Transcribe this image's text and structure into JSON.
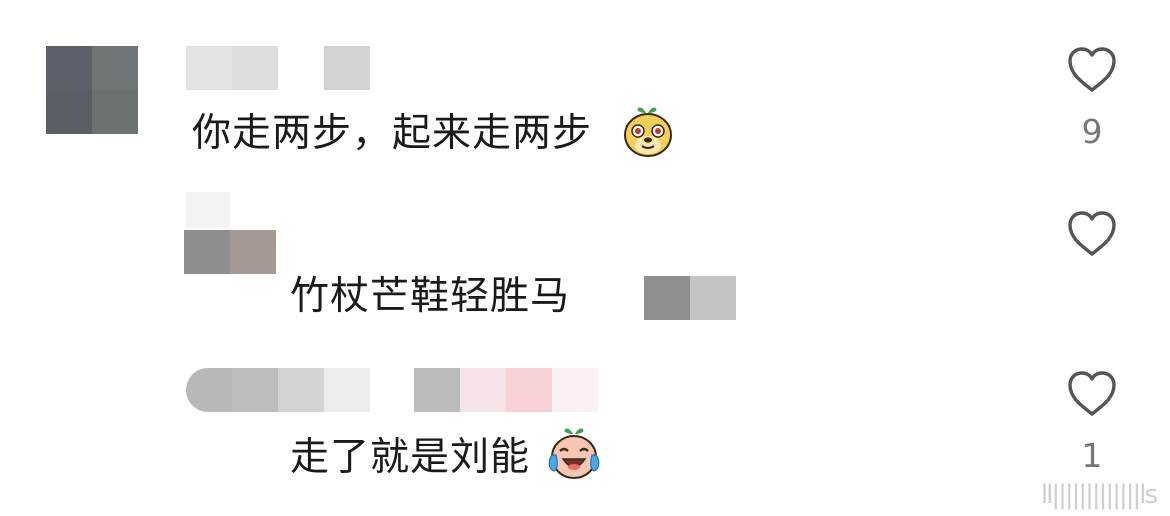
{
  "comments": [
    {
      "text": "你走两步，起来走两步",
      "emoji": "dog-face-emoji",
      "likes": "9",
      "avatar_colors": [
        "#5c6169",
        "#6f7477",
        "#5a5f66",
        "#6c7172"
      ],
      "username_colors": [
        "#e3e3e3",
        "#dcdcdc",
        "#ffffff",
        "#d2d2d2"
      ]
    },
    {
      "text": "竹杖芒鞋轻胜马",
      "likes": "",
      "avatar_colors": [
        "#8e8e8e",
        "#a59a93"
      ],
      "username_colors": [
        "#f3f3f3"
      ],
      "redacted_colors": [
        "#8f8f8f",
        "#c3c3c3"
      ]
    },
    {
      "text": "走了就是刘能",
      "emoji": "crying-laughing-emoji",
      "likes": "1",
      "username_colors": [
        "#b6b9b6",
        "#bdbdbd",
        "#d4d4d4",
        "#ededed",
        "#bcbcbc",
        "#f7e4e6",
        "#f6d1d5",
        "#fbf1f2"
      ]
    }
  ],
  "watermark": "ll|||||||||||||ls",
  "colors": {
    "text": "#1a1a1a",
    "count": "#777777",
    "heart_stroke": "#555555"
  }
}
